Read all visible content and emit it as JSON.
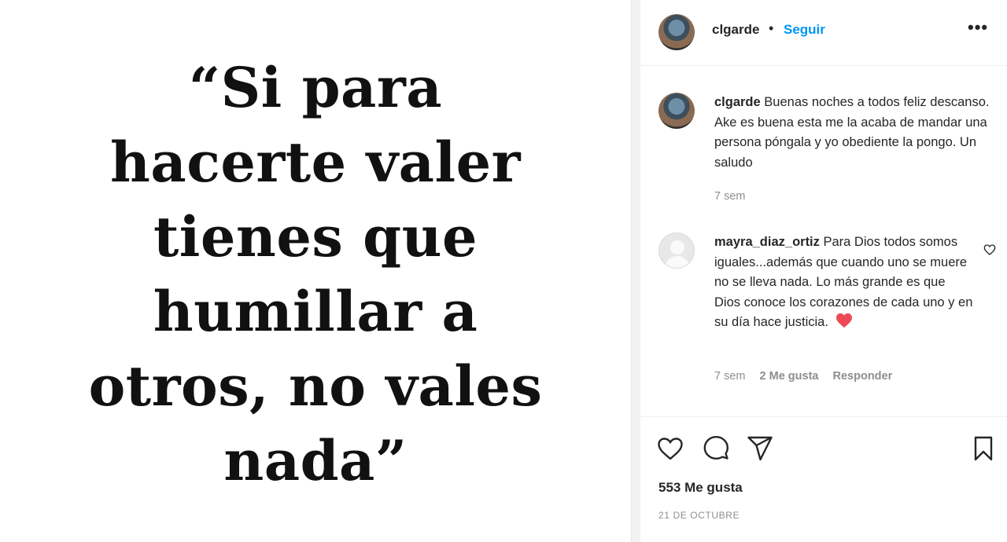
{
  "post": {
    "quote_lines": [
      "“Si para",
      "hacerte valer",
      "tienes que",
      "humillar a",
      "otros, no vales",
      "nada”"
    ]
  },
  "header": {
    "username": "clgarde",
    "dot": "•",
    "follow_label": "Seguir",
    "more_icon": "more-options-icon",
    "more_label": "•••"
  },
  "caption": {
    "username": "clgarde",
    "text": "Buenas noches a todos feliz descanso. Ake es buena esta me la acaba de mandar una persona póngala y yo obediente la pongo. Un saludo",
    "time": "7 sem"
  },
  "comments": [
    {
      "username": "mayra_diaz_ortiz",
      "text": "Para Dios todos somos iguales...además que cuando uno se muere no se lleva nada. Lo más grande es que Dios conoce los corazones de cada uno y en su día hace justicia.",
      "time": "7 sem",
      "likes": "2 Me gusta",
      "reply_label": "Responder"
    }
  ],
  "actions": {
    "like_icon": "heart-icon",
    "comment_icon": "comment-icon",
    "share_icon": "send-icon",
    "save_icon": "bookmark-icon"
  },
  "stats": {
    "likes": "553 Me gusta",
    "date": "21 DE OCTUBRE"
  },
  "colors": {
    "accent": "#0095f6",
    "muted": "#8e8e8e",
    "text": "#262626",
    "heart_red": "#ed4956"
  }
}
